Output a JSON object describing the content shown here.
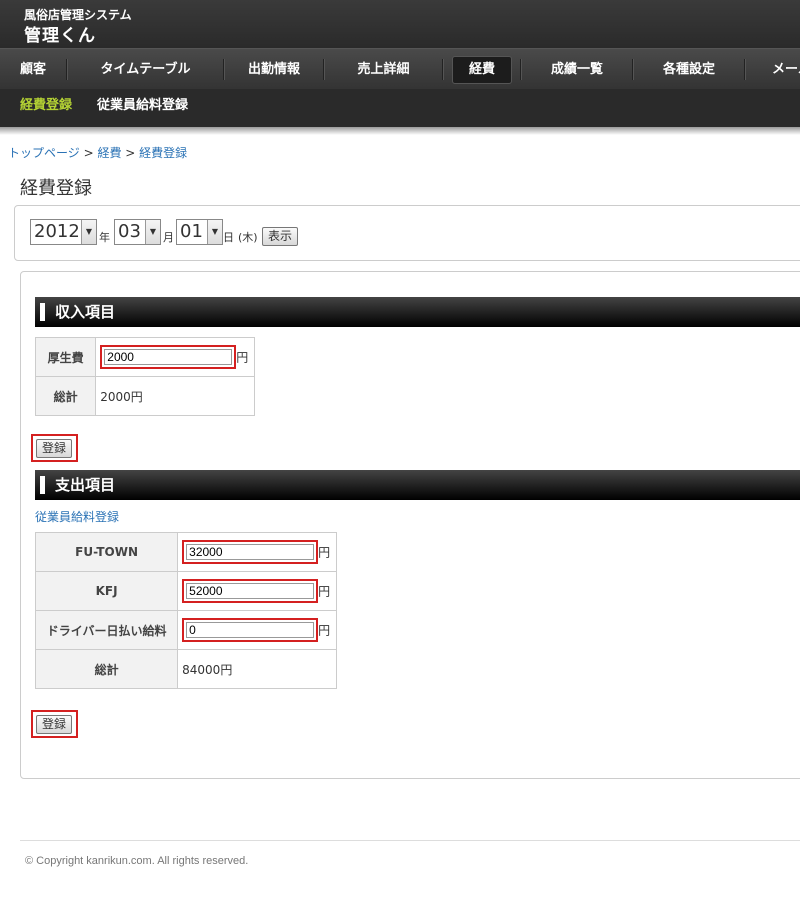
{
  "header": {
    "site_name": "風俗店管理システム",
    "app_title": "管理くん"
  },
  "nav": {
    "items": [
      {
        "label": "顧客"
      },
      {
        "label": "タイムテーブル"
      },
      {
        "label": "出勤情報"
      },
      {
        "label": "売上詳細"
      },
      {
        "label": "経費",
        "active": true
      },
      {
        "label": "成績一覧"
      },
      {
        "label": "各種設定"
      },
      {
        "label": "メール"
      }
    ],
    "sub_items": [
      {
        "label": "経費登録",
        "active": true
      },
      {
        "label": "従業員給料登録"
      }
    ]
  },
  "breadcrumb": {
    "home": "トップページ",
    "sep": " > ",
    "section": "経費",
    "current": "経費登録"
  },
  "page_title": "経費登録",
  "date_filter": {
    "year": "2012",
    "year_label": "年",
    "month": "03",
    "month_label": "月",
    "day": "01",
    "day_label": "日",
    "weekday": "(木)",
    "show_button": "表示"
  },
  "income": {
    "title": "収入項目",
    "rows": [
      {
        "label": "厚生費",
        "value": "2000",
        "unit": "円"
      }
    ],
    "total_label": "総計",
    "total_value": "2000円",
    "submit_label": "登録"
  },
  "expense": {
    "title": "支出項目",
    "link": "従業員給料登録",
    "rows": [
      {
        "label": "FU-TOWN",
        "value": "32000",
        "unit": "円"
      },
      {
        "label": "KFJ",
        "value": "52000",
        "unit": "円"
      },
      {
        "label": "ドライバー日払い給料",
        "value": "0",
        "unit": "円"
      }
    ],
    "total_label": "総計",
    "total_value": "84000円",
    "submit_label": "登録"
  },
  "footer": {
    "copyright": "© Copyright kanrikun.com. All rights reserved."
  },
  "colors": {
    "highlight": "#d42020",
    "sub_nav_active": "#b5d334",
    "link": "#2a72b5"
  }
}
